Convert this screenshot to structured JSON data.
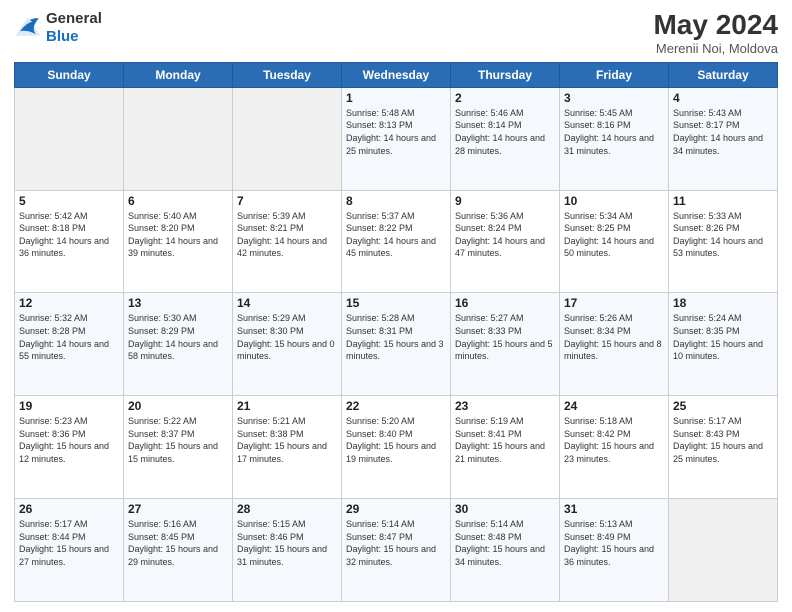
{
  "logo": {
    "line1": "General",
    "line2": "Blue"
  },
  "title": "May 2024",
  "subtitle": "Merenii Noi, Moldova",
  "days_of_week": [
    "Sunday",
    "Monday",
    "Tuesday",
    "Wednesday",
    "Thursday",
    "Friday",
    "Saturday"
  ],
  "weeks": [
    [
      {
        "day": "",
        "sunrise": "",
        "sunset": "",
        "daylight": ""
      },
      {
        "day": "",
        "sunrise": "",
        "sunset": "",
        "daylight": ""
      },
      {
        "day": "",
        "sunrise": "",
        "sunset": "",
        "daylight": ""
      },
      {
        "day": "1",
        "sunrise": "Sunrise: 5:48 AM",
        "sunset": "Sunset: 8:13 PM",
        "daylight": "Daylight: 14 hours and 25 minutes."
      },
      {
        "day": "2",
        "sunrise": "Sunrise: 5:46 AM",
        "sunset": "Sunset: 8:14 PM",
        "daylight": "Daylight: 14 hours and 28 minutes."
      },
      {
        "day": "3",
        "sunrise": "Sunrise: 5:45 AM",
        "sunset": "Sunset: 8:16 PM",
        "daylight": "Daylight: 14 hours and 31 minutes."
      },
      {
        "day": "4",
        "sunrise": "Sunrise: 5:43 AM",
        "sunset": "Sunset: 8:17 PM",
        "daylight": "Daylight: 14 hours and 34 minutes."
      }
    ],
    [
      {
        "day": "5",
        "sunrise": "Sunrise: 5:42 AM",
        "sunset": "Sunset: 8:18 PM",
        "daylight": "Daylight: 14 hours and 36 minutes."
      },
      {
        "day": "6",
        "sunrise": "Sunrise: 5:40 AM",
        "sunset": "Sunset: 8:20 PM",
        "daylight": "Daylight: 14 hours and 39 minutes."
      },
      {
        "day": "7",
        "sunrise": "Sunrise: 5:39 AM",
        "sunset": "Sunset: 8:21 PM",
        "daylight": "Daylight: 14 hours and 42 minutes."
      },
      {
        "day": "8",
        "sunrise": "Sunrise: 5:37 AM",
        "sunset": "Sunset: 8:22 PM",
        "daylight": "Daylight: 14 hours and 45 minutes."
      },
      {
        "day": "9",
        "sunrise": "Sunrise: 5:36 AM",
        "sunset": "Sunset: 8:24 PM",
        "daylight": "Daylight: 14 hours and 47 minutes."
      },
      {
        "day": "10",
        "sunrise": "Sunrise: 5:34 AM",
        "sunset": "Sunset: 8:25 PM",
        "daylight": "Daylight: 14 hours and 50 minutes."
      },
      {
        "day": "11",
        "sunrise": "Sunrise: 5:33 AM",
        "sunset": "Sunset: 8:26 PM",
        "daylight": "Daylight: 14 hours and 53 minutes."
      }
    ],
    [
      {
        "day": "12",
        "sunrise": "Sunrise: 5:32 AM",
        "sunset": "Sunset: 8:28 PM",
        "daylight": "Daylight: 14 hours and 55 minutes."
      },
      {
        "day": "13",
        "sunrise": "Sunrise: 5:30 AM",
        "sunset": "Sunset: 8:29 PM",
        "daylight": "Daylight: 14 hours and 58 minutes."
      },
      {
        "day": "14",
        "sunrise": "Sunrise: 5:29 AM",
        "sunset": "Sunset: 8:30 PM",
        "daylight": "Daylight: 15 hours and 0 minutes."
      },
      {
        "day": "15",
        "sunrise": "Sunrise: 5:28 AM",
        "sunset": "Sunset: 8:31 PM",
        "daylight": "Daylight: 15 hours and 3 minutes."
      },
      {
        "day": "16",
        "sunrise": "Sunrise: 5:27 AM",
        "sunset": "Sunset: 8:33 PM",
        "daylight": "Daylight: 15 hours and 5 minutes."
      },
      {
        "day": "17",
        "sunrise": "Sunrise: 5:26 AM",
        "sunset": "Sunset: 8:34 PM",
        "daylight": "Daylight: 15 hours and 8 minutes."
      },
      {
        "day": "18",
        "sunrise": "Sunrise: 5:24 AM",
        "sunset": "Sunset: 8:35 PM",
        "daylight": "Daylight: 15 hours and 10 minutes."
      }
    ],
    [
      {
        "day": "19",
        "sunrise": "Sunrise: 5:23 AM",
        "sunset": "Sunset: 8:36 PM",
        "daylight": "Daylight: 15 hours and 12 minutes."
      },
      {
        "day": "20",
        "sunrise": "Sunrise: 5:22 AM",
        "sunset": "Sunset: 8:37 PM",
        "daylight": "Daylight: 15 hours and 15 minutes."
      },
      {
        "day": "21",
        "sunrise": "Sunrise: 5:21 AM",
        "sunset": "Sunset: 8:38 PM",
        "daylight": "Daylight: 15 hours and 17 minutes."
      },
      {
        "day": "22",
        "sunrise": "Sunrise: 5:20 AM",
        "sunset": "Sunset: 8:40 PM",
        "daylight": "Daylight: 15 hours and 19 minutes."
      },
      {
        "day": "23",
        "sunrise": "Sunrise: 5:19 AM",
        "sunset": "Sunset: 8:41 PM",
        "daylight": "Daylight: 15 hours and 21 minutes."
      },
      {
        "day": "24",
        "sunrise": "Sunrise: 5:18 AM",
        "sunset": "Sunset: 8:42 PM",
        "daylight": "Daylight: 15 hours and 23 minutes."
      },
      {
        "day": "25",
        "sunrise": "Sunrise: 5:17 AM",
        "sunset": "Sunset: 8:43 PM",
        "daylight": "Daylight: 15 hours and 25 minutes."
      }
    ],
    [
      {
        "day": "26",
        "sunrise": "Sunrise: 5:17 AM",
        "sunset": "Sunset: 8:44 PM",
        "daylight": "Daylight: 15 hours and 27 minutes."
      },
      {
        "day": "27",
        "sunrise": "Sunrise: 5:16 AM",
        "sunset": "Sunset: 8:45 PM",
        "daylight": "Daylight: 15 hours and 29 minutes."
      },
      {
        "day": "28",
        "sunrise": "Sunrise: 5:15 AM",
        "sunset": "Sunset: 8:46 PM",
        "daylight": "Daylight: 15 hours and 31 minutes."
      },
      {
        "day": "29",
        "sunrise": "Sunrise: 5:14 AM",
        "sunset": "Sunset: 8:47 PM",
        "daylight": "Daylight: 15 hours and 32 minutes."
      },
      {
        "day": "30",
        "sunrise": "Sunrise: 5:14 AM",
        "sunset": "Sunset: 8:48 PM",
        "daylight": "Daylight: 15 hours and 34 minutes."
      },
      {
        "day": "31",
        "sunrise": "Sunrise: 5:13 AM",
        "sunset": "Sunset: 8:49 PM",
        "daylight": "Daylight: 15 hours and 36 minutes."
      },
      {
        "day": "",
        "sunrise": "",
        "sunset": "",
        "daylight": ""
      }
    ]
  ]
}
